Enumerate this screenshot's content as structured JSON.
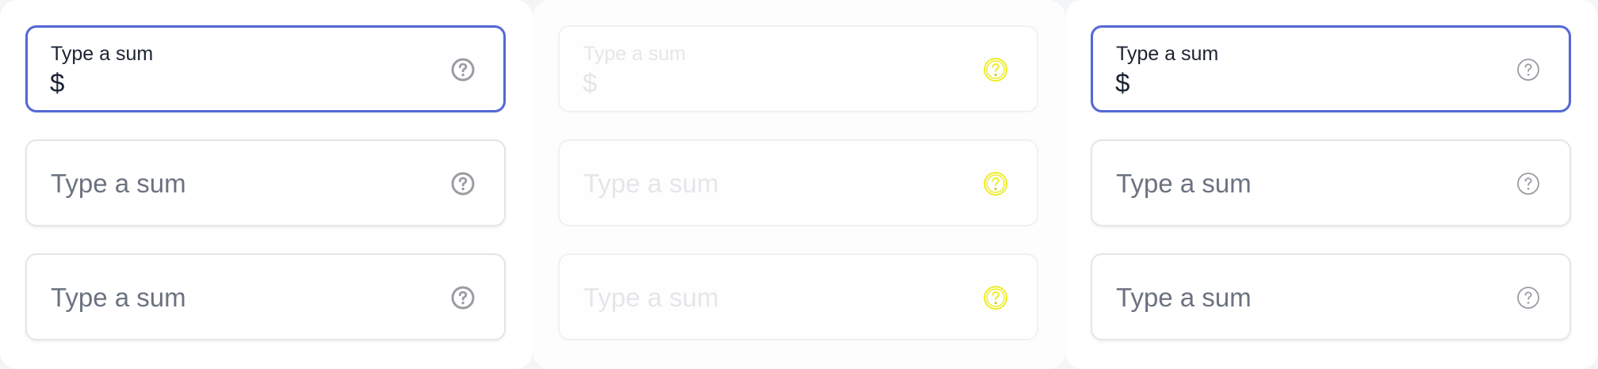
{
  "colors": {
    "focus_border": "#5468d4",
    "text_dark": "#1b2333",
    "placeholder": "#6b7280",
    "disabled_text": "#e5e6ea",
    "help_icon_default": "#9a9ca3",
    "help_icon_disabled": "#eded28"
  },
  "panels": [
    {
      "fields": [
        {
          "state": "focused",
          "label": "Type a sum",
          "prefix": "$",
          "icon": "help-circle-icon"
        },
        {
          "state": "empty",
          "placeholder": "Type a sum",
          "icon": "help-circle-icon"
        },
        {
          "state": "empty",
          "placeholder": "Type a sum",
          "icon": "help-circle-icon"
        }
      ]
    },
    {
      "fields": [
        {
          "state": "disabled",
          "label": "Type a sum",
          "prefix": "$",
          "icon": "help-circle-icon"
        },
        {
          "state": "disabled",
          "placeholder": "Type a sum",
          "icon": "help-circle-icon"
        },
        {
          "state": "disabled",
          "placeholder": "Type a sum",
          "icon": "help-circle-icon"
        }
      ]
    },
    {
      "fields": [
        {
          "state": "focused",
          "label": "Type a sum",
          "prefix": "$",
          "icon": "help-circle-outline-icon"
        },
        {
          "state": "empty",
          "placeholder": "Type a sum",
          "icon": "help-circle-outline-icon"
        },
        {
          "state": "empty",
          "placeholder": "Type a sum",
          "icon": "help-circle-outline-icon"
        }
      ]
    }
  ]
}
